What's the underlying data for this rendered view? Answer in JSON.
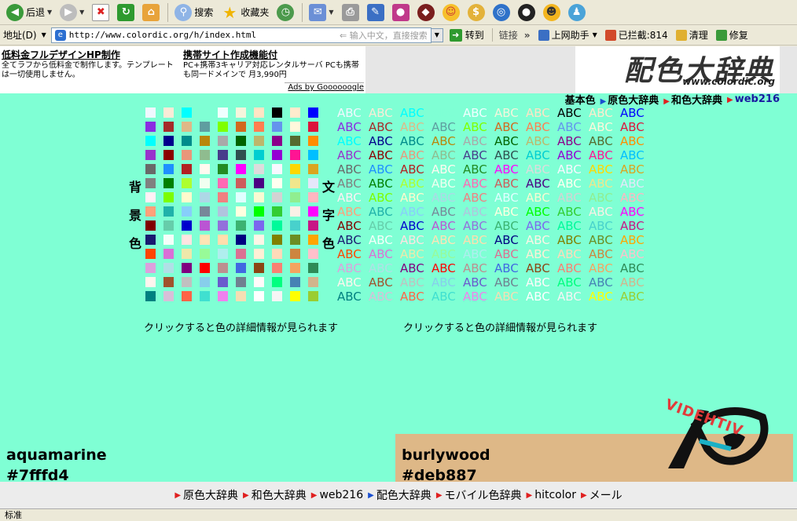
{
  "toolbar": {
    "back": "后退",
    "search": "搜索",
    "favorites": "收藏夹"
  },
  "address": {
    "label": "地址(D)",
    "url": "http://www.colordic.org/h/index.html",
    "hint": "输入中文，直接搜索",
    "go": "转到",
    "links": "链接",
    "helper": "上网助手",
    "blocked": "已拦截:814",
    "clean": "清理",
    "repair": "修复"
  },
  "ads": {
    "ad1_title": "低料金フルデザインHP制作",
    "ad1_text": "全てラフから低料金で制作します。テンプレートは一切使用しません。",
    "ad2_title": "携帯サイト作成機能付",
    "ad2_text": "PC+携帯3キャリア対応レンタルサーバ PCも携帯も同一ドメインで 月3,990円",
    "ads_by": "Ads by Goooooogle"
  },
  "logo": {
    "main": "配色大辞典",
    "sub": "www.colordic.org"
  },
  "topnav": [
    "基本色",
    "原色大辞典",
    "和色大辞典",
    "web216"
  ],
  "labels": {
    "bg": [
      "背",
      "景",
      "色"
    ],
    "fg": [
      "文",
      "字",
      "色"
    ],
    "note_left": "クリックすると色の詳細情報が見られます",
    "note_right": "クリックすると色の詳細情報が見られます",
    "abc": "ABC"
  },
  "bg_colors": [
    [
      "#f0f8ff",
      "#faebd7",
      "#00ffff",
      "#7fffd4",
      "#f0ffff",
      "#f5f5dc",
      "#ffe4c4",
      "#000000",
      "#ffebcd",
      "#0000ff"
    ],
    [
      "#8a2be2",
      "#a52a2a",
      "#deb887",
      "#5f9ea0",
      "#7fff00",
      "#d2691e",
      "#ff7f50",
      "#6495ed",
      "#fff8dc",
      "#dc143c"
    ],
    [
      "#00ffff",
      "#00008b",
      "#008b8b",
      "#b8860b",
      "#a9a9a9",
      "#006400",
      "#bdb76b",
      "#8b008b",
      "#556b2f",
      "#ff8c00"
    ],
    [
      "#9932cc",
      "#8b0000",
      "#e9967a",
      "#8fbc8f",
      "#483d8b",
      "#2f4f4f",
      "#00ced1",
      "#9400d3",
      "#ff1493",
      "#00bfff"
    ],
    [
      "#696969",
      "#1e90ff",
      "#b22222",
      "#fffaf0",
      "#228b22",
      "#ff00ff",
      "#dcdcdc",
      "#f8f8ff",
      "#ffd700",
      "#daa520"
    ],
    [
      "#808080",
      "#008000",
      "#adff2f",
      "#f0fff0",
      "#ff69b4",
      "#cd5c5c",
      "#4b0082",
      "#fffff0",
      "#f0e68c",
      "#e6e6fa"
    ],
    [
      "#fff0f5",
      "#7cfc00",
      "#fffacd",
      "#add8e6",
      "#f08080",
      "#e0ffff",
      "#fafad2",
      "#d3d3d3",
      "#90ee90",
      "#ffb6c1"
    ],
    [
      "#ffa07a",
      "#20b2aa",
      "#87cefa",
      "#778899",
      "#b0c4de",
      "#ffffe0",
      "#00ff00",
      "#32cd32",
      "#faf0e6",
      "#ff00ff"
    ],
    [
      "#800000",
      "#66cdaa",
      "#0000cd",
      "#ba55d3",
      "#9370db",
      "#3cb371",
      "#7b68ee",
      "#00fa9a",
      "#48d1cc",
      "#c71585"
    ],
    [
      "#191970",
      "#f5fffa",
      "#ffe4e1",
      "#ffe4b5",
      "#ffdead",
      "#000080",
      "#fdf5e6",
      "#808000",
      "#6b8e23",
      "#ffa500"
    ],
    [
      "#ff4500",
      "#da70d6",
      "#eee8aa",
      "#98fb98",
      "#afeeee",
      "#db7093",
      "#ffefd5",
      "#ffdab9",
      "#cd853f",
      "#ffc0cb"
    ],
    [
      "#dda0dd",
      "#b0e0e6",
      "#800080",
      "#ff0000",
      "#bc8f8f",
      "#4169e1",
      "#8b4513",
      "#fa8072",
      "#f4a460",
      "#2e8b57"
    ],
    [
      "#fff5ee",
      "#a0522d",
      "#c0c0c0",
      "#87ceeb",
      "#6a5acd",
      "#708090",
      "#fffafa",
      "#00ff7f",
      "#4682b4",
      "#d2b48c"
    ],
    [
      "#008080",
      "#d8bfd8",
      "#ff6347",
      "#40e0d0",
      "#ee82ee",
      "#f5deb3",
      "#ffffff",
      "#f5f5f5",
      "#ffff00",
      "#9acd32"
    ]
  ],
  "page": {
    "left_name": "aquamarine",
    "left_hex": "#7fffd4",
    "right_name": "burlywood",
    "right_hex": "#deb887",
    "mascot_text": "VIDEHTIV"
  },
  "botnav": [
    "原色大辞典",
    "和色大辞典",
    "web216",
    "配色大辞典",
    "モバイル色辞典",
    "hitcolor",
    "メール"
  ],
  "status": "标准"
}
